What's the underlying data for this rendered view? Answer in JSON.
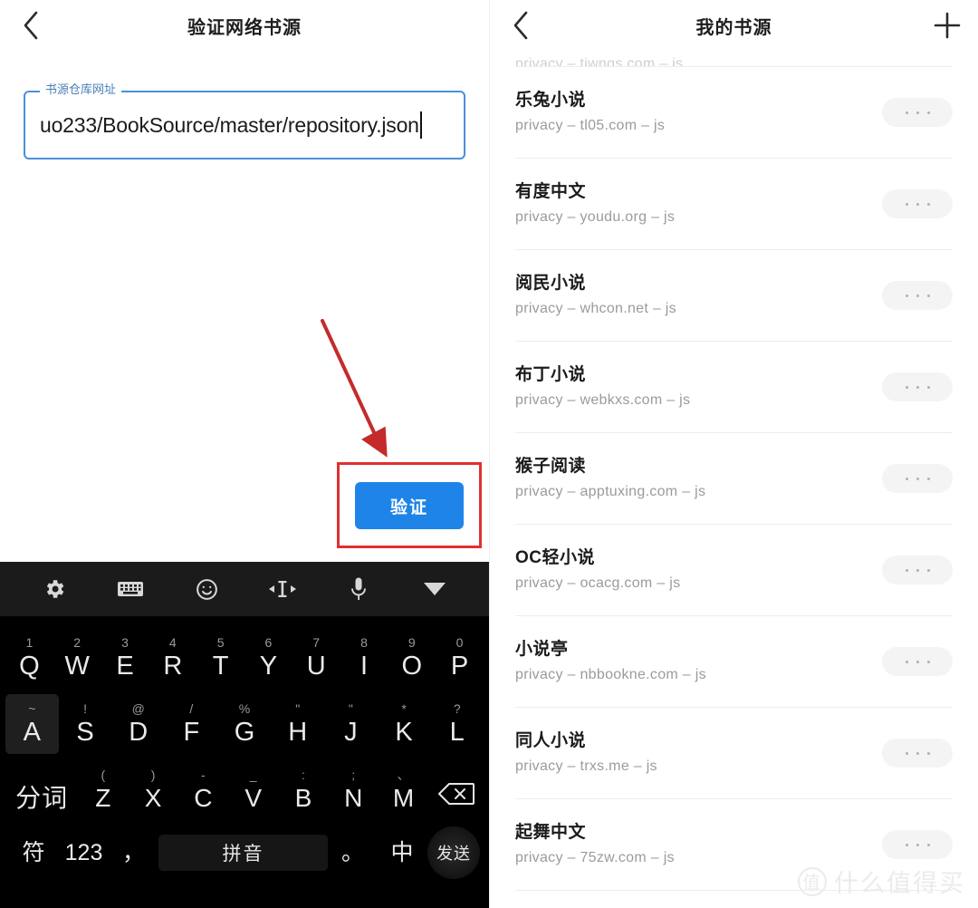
{
  "left": {
    "appbar": {
      "title": "验证网络书源",
      "back_icon": "chevron-left-icon"
    },
    "field": {
      "label": "书源仓库网址",
      "value": "uo233/BookSource/master/repository.json",
      "placeholder": "书源仓库网址",
      "border_color": "#4a90d9",
      "label_color": "#4a7fb5"
    },
    "verify_button": {
      "label": "验证",
      "color": "#1e84e8"
    },
    "annotation": {
      "box_color": "#e03030",
      "arrow_color": "#c42b2b"
    }
  },
  "keyboard": {
    "toolbar": [
      {
        "name": "gear-icon"
      },
      {
        "name": "keyboard-icon"
      },
      {
        "name": "emoji-icon"
      },
      {
        "name": "cursor-move-icon"
      },
      {
        "name": "microphone-icon"
      },
      {
        "name": "collapse-keyboard-icon"
      }
    ],
    "row1": [
      {
        "sup": "1",
        "main": "Q"
      },
      {
        "sup": "2",
        "main": "W"
      },
      {
        "sup": "3",
        "main": "E"
      },
      {
        "sup": "4",
        "main": "R"
      },
      {
        "sup": "5",
        "main": "T"
      },
      {
        "sup": "6",
        "main": "Y"
      },
      {
        "sup": "7",
        "main": "U"
      },
      {
        "sup": "8",
        "main": "I"
      },
      {
        "sup": "9",
        "main": "O"
      },
      {
        "sup": "0",
        "main": "P"
      }
    ],
    "row2": [
      {
        "sup": "~",
        "main": "A",
        "pressed": true
      },
      {
        "sup": "!",
        "main": "S"
      },
      {
        "sup": "@",
        "main": "D"
      },
      {
        "sup": "/",
        "main": "F"
      },
      {
        "sup": "%",
        "main": "G"
      },
      {
        "sup": "\"",
        "main": "H"
      },
      {
        "sup": "\"",
        "main": "J"
      },
      {
        "sup": "*",
        "main": "K"
      },
      {
        "sup": "?",
        "main": "L"
      }
    ],
    "row3": [
      {
        "sup": "",
        "main": "分词"
      },
      {
        "sup": "(",
        "main": "Z"
      },
      {
        "sup": ")",
        "main": "X"
      },
      {
        "sup": "-",
        "main": "C"
      },
      {
        "sup": "_",
        "main": "V"
      },
      {
        "sup": ":",
        "main": "B"
      },
      {
        "sup": ";",
        "main": "N"
      },
      {
        "sup": "、",
        "main": "M"
      },
      {
        "sup": "",
        "main": "backspace-icon"
      }
    ],
    "row4": [
      {
        "main": "符"
      },
      {
        "main": "123"
      },
      {
        "main": "，"
      },
      {
        "main": "拼音"
      },
      {
        "main": "。"
      },
      {
        "main": "中"
      },
      {
        "main": "发送"
      }
    ]
  },
  "right": {
    "appbar": {
      "title": "我的书源",
      "back_icon": "chevron-left-icon",
      "add_icon": "plus-icon"
    },
    "items": [
      {
        "name": "",
        "meta": "privacy  –  tjwngs.com  –  js",
        "clipped": true
      },
      {
        "name": "乐兔小说",
        "meta": "privacy  –  tl05.com  –  js"
      },
      {
        "name": "有度中文",
        "meta": "privacy  –  youdu.org  –  js"
      },
      {
        "name": "阅民小说",
        "meta": "privacy  –  whcon.net  –  js"
      },
      {
        "name": "布丁小说",
        "meta": "privacy  –  webkxs.com  –  js"
      },
      {
        "name": "猴子阅读",
        "meta": "privacy  –  apptuxing.com  –  js"
      },
      {
        "name": "OC轻小说",
        "meta": "privacy  –  ocacg.com  –  js"
      },
      {
        "name": "小说亭",
        "meta": "privacy  –  nbbookne.com  –  js"
      },
      {
        "name": "同人小说",
        "meta": "privacy  –  trxs.me  –  js"
      },
      {
        "name": "起舞中文",
        "meta": "privacy  –  75zw.com  –  js"
      }
    ],
    "watermark": {
      "badge": "值",
      "text": "什么值得买"
    }
  }
}
